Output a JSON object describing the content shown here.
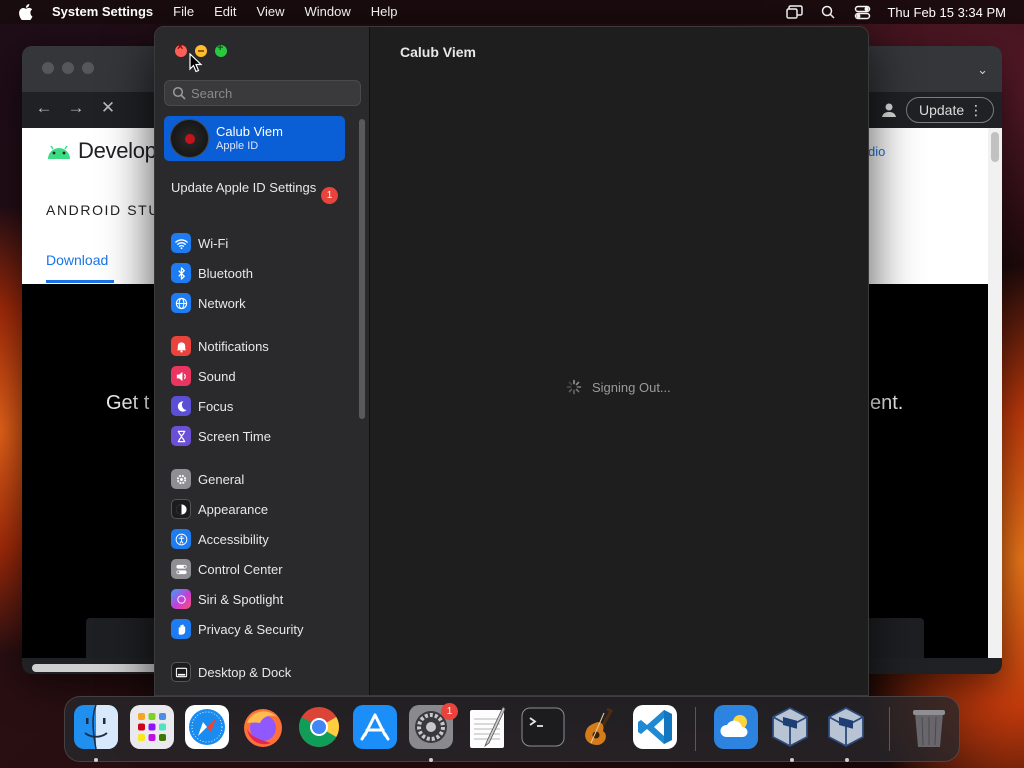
{
  "menubar": {
    "app_name": "System Settings",
    "menus": [
      "File",
      "Edit",
      "View",
      "Window",
      "Help"
    ],
    "clock": "Thu Feb 15  3:34 PM"
  },
  "browser": {
    "update_label": "Update",
    "page": {
      "logo_text": "Develope",
      "subbrand": "ANDROID STU",
      "tab_download": "Download",
      "right_link": "dio",
      "hero_left": "Get t",
      "hero_right": "ent."
    }
  },
  "settings": {
    "search_placeholder": "Search",
    "account": {
      "name": "Calub Viem",
      "sub": "Apple ID"
    },
    "update_prompt": "Update Apple ID Settings",
    "update_badge": "1",
    "sidebar_items": [
      {
        "label": "Wi-Fi",
        "icon": "wifi-icon",
        "color": "#1e7cf2"
      },
      {
        "label": "Bluetooth",
        "icon": "bluetooth-icon",
        "color": "#1e7cf2"
      },
      {
        "label": "Network",
        "icon": "globe-icon",
        "color": "#1e7cf2"
      },
      {
        "label": "Notifications",
        "icon": "bell-icon",
        "color": "#e9433b"
      },
      {
        "label": "Sound",
        "icon": "speaker-icon",
        "color": "#e9355f"
      },
      {
        "label": "Focus",
        "icon": "moon-icon",
        "color": "#5b4fd6"
      },
      {
        "label": "Screen Time",
        "icon": "hourglass-icon",
        "color": "#6a50d6"
      },
      {
        "label": "General",
        "icon": "gear-icon",
        "color": "#8e8e93"
      },
      {
        "label": "Appearance",
        "icon": "appearance-icon",
        "color": "#1c1c1e"
      },
      {
        "label": "Accessibility",
        "icon": "accessibility-icon",
        "color": "#1e7cf2"
      },
      {
        "label": "Control Center",
        "icon": "control-center-icon",
        "color": "#8e8e93"
      },
      {
        "label": "Siri & Spotlight",
        "icon": "siri-icon",
        "color": "#c43fd6"
      },
      {
        "label": "Privacy & Security",
        "icon": "hand-icon",
        "color": "#1e7cf2"
      },
      {
        "label": "Desktop & Dock",
        "icon": "dock-icon",
        "color": "#1c1c1e"
      }
    ],
    "content_title": "Calub Viem",
    "status_text": "Signing Out..."
  },
  "dock": {
    "badge": "1",
    "apps": [
      "finder-icon",
      "launchpad-icon",
      "safari-icon",
      "firefox-icon",
      "chrome-icon",
      "app-store-icon",
      "system-settings-icon",
      "textedit-icon",
      "terminal-icon",
      "garageband-icon",
      "vscode-icon",
      "weather-icon",
      "virtualbox-icon",
      "virtualbox-vm-icon",
      "trash-icon"
    ]
  }
}
